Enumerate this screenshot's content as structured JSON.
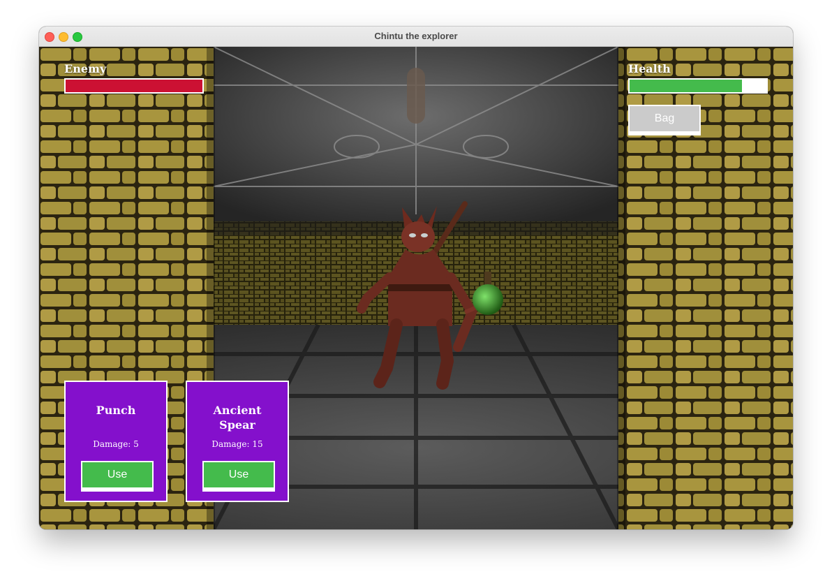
{
  "window": {
    "title": "Chintu the explorer"
  },
  "hud": {
    "enemy": {
      "label": "Enemy",
      "value_fraction": 1.0,
      "color": "#cc1133"
    },
    "health": {
      "label": "Health",
      "value_fraction": 0.82,
      "color": "#44bb4c"
    },
    "bag_label": "Bag"
  },
  "attacks": [
    {
      "name": "Punch",
      "damage_text": "Damage: 5",
      "button_label": "Use"
    },
    {
      "name": "Ancient Spear",
      "damage_text": "Damage: 15",
      "button_label": "Use"
    }
  ],
  "colors": {
    "card_bg": "#8410cc",
    "button_green": "#44bb4c",
    "bag_gray": "#cbcbcb",
    "wall_sandstone": "#a8953e",
    "stone_gray": "#5a5a5a"
  },
  "scene": {
    "setting": "dungeon-corridor",
    "enemy_sprite": "horned-demon",
    "item_sprite": "green-potion"
  }
}
